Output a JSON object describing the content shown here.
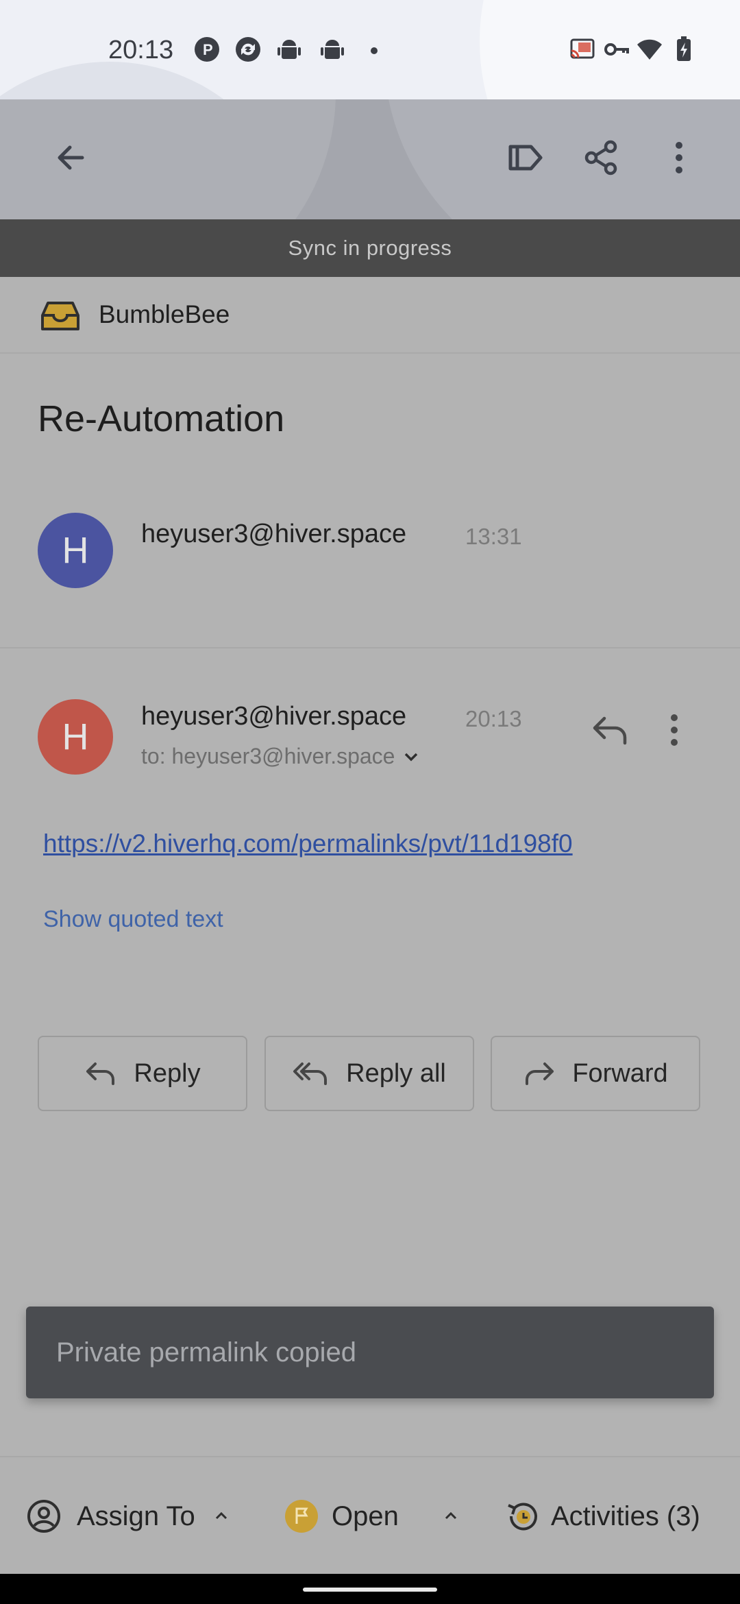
{
  "status_bar": {
    "time": "20:13",
    "left_icons": [
      "p-badge-icon",
      "sync-app-icon",
      "android-icon",
      "android-icon",
      "dot-icon"
    ],
    "right_icons": [
      "cast-icon",
      "vpn-key-icon",
      "wifi-icon",
      "battery-charging-icon"
    ]
  },
  "app_bar": {
    "back_icon": "arrow-left-icon",
    "actions": [
      "label-icon",
      "share-icon",
      "more-vert-icon"
    ]
  },
  "sync_banner": "Sync in progress",
  "inbox": {
    "name": "BumbleBee",
    "icon": "inbox-tray-icon"
  },
  "subject": "Re-Automation",
  "messages": [
    {
      "avatar_letter": "H",
      "avatar_color": "#4b54a0",
      "sender": "heyuser3@hiver.space",
      "time": "13:31"
    },
    {
      "avatar_letter": "H",
      "avatar_color": "#c0564a",
      "sender": "heyuser3@hiver.space",
      "time": "20:13",
      "to": "to: heyuser3@hiver.space",
      "link": "https://v2.hiverhq.com/permalinks/pvt/11d198f0",
      "show_quoted": "Show quoted text"
    }
  ],
  "actions": {
    "reply": "Reply",
    "reply_all": "Reply all",
    "forward": "Forward"
  },
  "snackbar": "Private permalink copied",
  "bottom_bar": {
    "assign": "Assign To",
    "status": "Open",
    "activities": "Activities (3)",
    "status_color": "#c9a035"
  }
}
